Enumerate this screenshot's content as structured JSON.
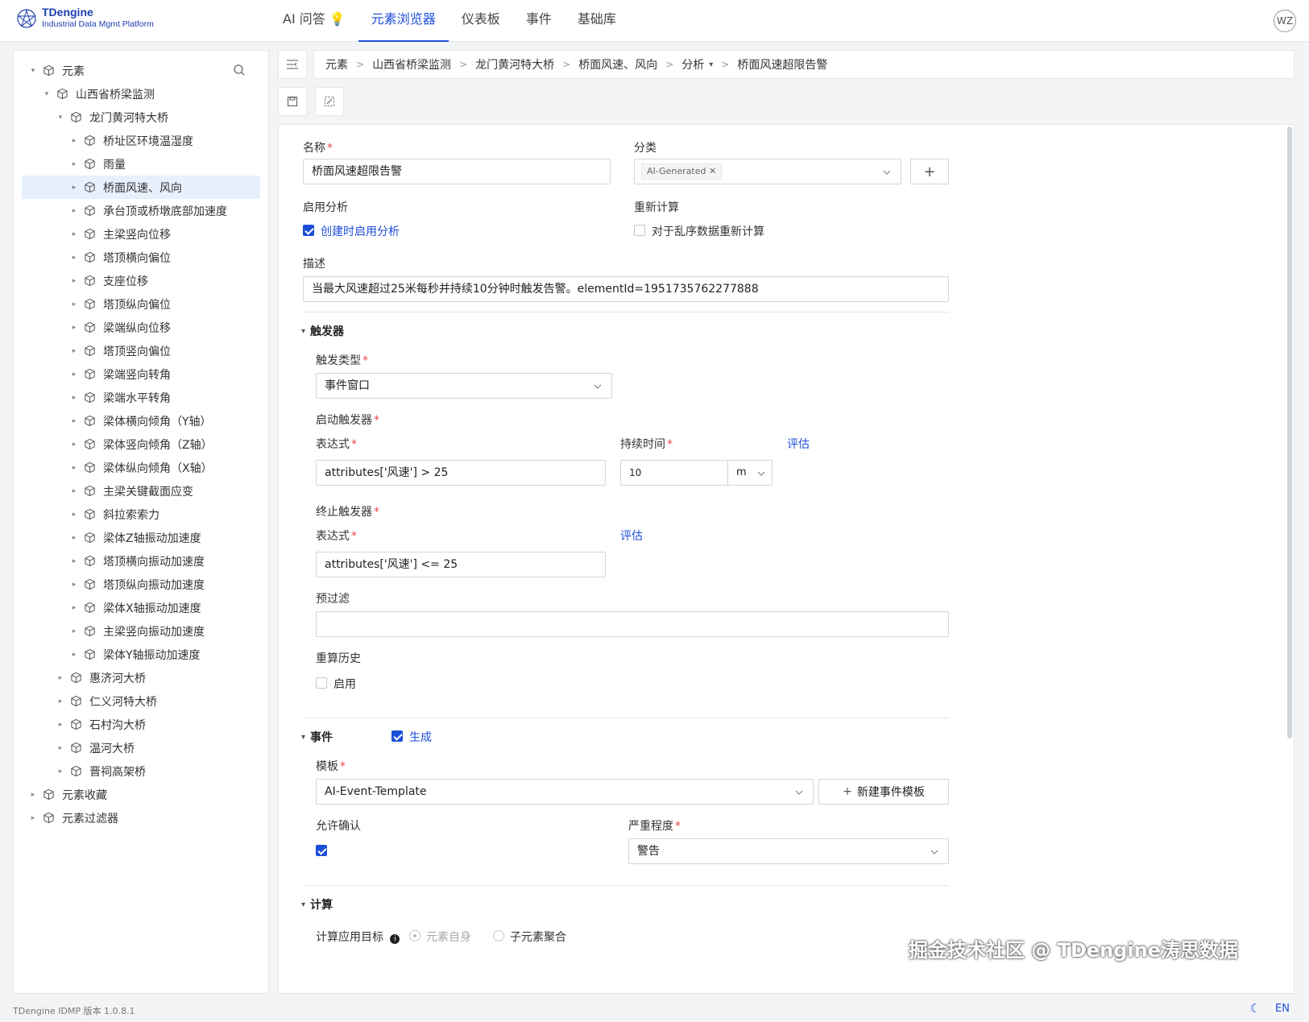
{
  "app": {
    "brand": "TDengine",
    "subtitle": "Industrial Data Mgmt Platform",
    "avatar": "WZ",
    "version": "TDengine IDMP 版本 1.0.8.1",
    "lang": "EN",
    "accent": "#1d4ed8"
  },
  "nav": [
    {
      "label": "AI 问答"
    },
    {
      "label": "元素浏览器"
    },
    {
      "label": "仪表板"
    },
    {
      "label": "事件"
    },
    {
      "label": "基础库"
    }
  ],
  "tree": {
    "root": "元素",
    "items": [
      {
        "label": "山西省桥梁监测"
      },
      {
        "label": "龙门黄河特大桥"
      },
      {
        "label": "桥址区环境温湿度"
      },
      {
        "label": "雨量"
      },
      {
        "label": "桥面风速、风向"
      },
      {
        "label": "承台顶或桥墩底部加速度"
      },
      {
        "label": "主梁竖向位移"
      },
      {
        "label": "塔顶横向偏位"
      },
      {
        "label": "支座位移"
      },
      {
        "label": "塔顶纵向偏位"
      },
      {
        "label": "梁端纵向位移"
      },
      {
        "label": "塔顶竖向偏位"
      },
      {
        "label": "梁端竖向转角"
      },
      {
        "label": "梁端水平转角"
      },
      {
        "label": "梁体横向倾角（Y轴）"
      },
      {
        "label": "梁体竖向倾角（Z轴）"
      },
      {
        "label": "梁体纵向倾角（X轴）"
      },
      {
        "label": "主梁关键截面应变"
      },
      {
        "label": "斜拉索索力"
      },
      {
        "label": "梁体Z轴振动加速度"
      },
      {
        "label": "塔顶横向振动加速度"
      },
      {
        "label": "塔顶纵向振动加速度"
      },
      {
        "label": "梁体X轴振动加速度"
      },
      {
        "label": "主梁竖向振动加速度"
      },
      {
        "label": "梁体Y轴振动加速度"
      },
      {
        "label": "惠济河大桥"
      },
      {
        "label": "仁义河特大桥"
      },
      {
        "label": "石村沟大桥"
      },
      {
        "label": "温河大桥"
      },
      {
        "label": "晋祠高架桥"
      },
      {
        "label": "元素收藏"
      },
      {
        "label": "元素过滤器"
      }
    ]
  },
  "breadcrumb": [
    "元素",
    "山西省桥梁监测",
    "龙门黄河特大桥",
    "桥面风速、风向",
    "分析",
    "桥面风速超限告警"
  ],
  "form": {
    "name_label": "名称",
    "name_value": "桥面风速超限告警",
    "category_label": "分类",
    "category_tag": "AI-Generated",
    "enable_label": "启用分析",
    "enable_option": "创建时启用分析",
    "recalc_label": "重新计算",
    "recalc_option": "对于乱序数据重新计算",
    "desc_label": "描述",
    "desc_value": "当最大风速超过25米每秒并持续10分钟时触发告警。elementId=1951735762277888"
  },
  "trigger": {
    "title": "触发器",
    "type_label": "触发类型",
    "type_value": "事件窗口",
    "start_label": "启动触发器",
    "expr_label": "表达式",
    "start_expr": "attributes['风速'] > 25",
    "duration_label": "持续时间",
    "duration_value": "10",
    "duration_unit": "m",
    "evaluate": "评估",
    "end_label": "终止触发器",
    "end_expr": "attributes['风速'] <= 25",
    "prefilter_label": "预过滤",
    "prefilter_value": "",
    "history_label": "重算历史",
    "history_option": "启用"
  },
  "event": {
    "title": "事件",
    "generate": "生成",
    "template_label": "模板",
    "template_value": "AI-Event-Template",
    "new_template": "新建事件模板",
    "ack_label": "允许确认",
    "severity_label": "严重程度",
    "severity_value": "警告"
  },
  "compute": {
    "title": "计算",
    "target_label": "计算应用目标",
    "opt_self": "元素自身",
    "opt_children": "子元素聚合"
  },
  "watermark": "掘金技术社区 @ TDengine涛思数据"
}
